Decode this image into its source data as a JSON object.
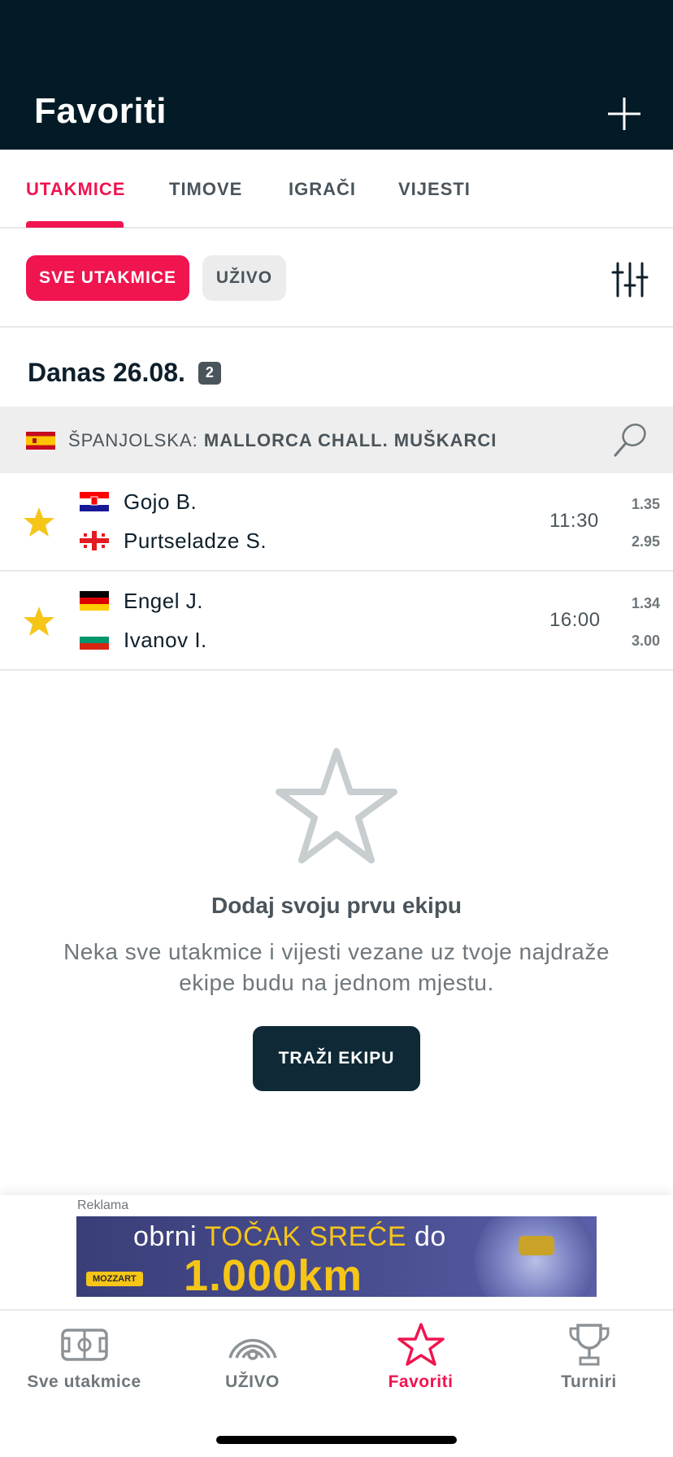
{
  "header": {
    "title": "Favoriti",
    "add_icon": "plus-icon"
  },
  "tabs": [
    {
      "label": "UTAKMICE",
      "active": true
    },
    {
      "label": "TIMOVE",
      "active": false
    },
    {
      "label": "IGRAČI",
      "active": false
    },
    {
      "label": "VIJESTI",
      "active": false
    }
  ],
  "filters": {
    "all_label": "SVE UTAKMICE",
    "live_label": "UŽIVO",
    "settings_icon": "sliders-icon"
  },
  "date_section": {
    "title": "Danas 26.08.",
    "count": "2"
  },
  "league": {
    "country": "ŠPANJOLSKA: ",
    "name": "MALLORCA CHALL. MUŠKARCI",
    "flag": "spain-flag",
    "sport_icon": "tennis-racket-icon"
  },
  "matches": [
    {
      "home": "Gojo B.",
      "home_flag": "croatia-flag",
      "away": "Purtseladze S.",
      "away_flag": "georgia-flag",
      "time": "11:30",
      "odd_home": "1.35",
      "odd_away": "2.95"
    },
    {
      "home": "Engel J.",
      "home_flag": "germany-flag",
      "away": "Ivanov I.",
      "away_flag": "bulgaria-flag",
      "time": "16:00",
      "odd_home": "1.34",
      "odd_away": "3.00"
    }
  ],
  "empty_state": {
    "title": "Dodaj svoju prvu ekipu",
    "text": "Neka sve utakmice i vijesti vezane uz tvoje najdraže ekipe budu na jednom mjestu.",
    "button": "TRAŽI EKIPU"
  },
  "ad": {
    "label": "Reklama",
    "line1_prefix": "obrni ",
    "line1_highlight": "TOČAK SREĆE",
    "line1_suffix": " do",
    "line2": "1.000km",
    "logo": "MOZZART"
  },
  "bottom_nav": [
    {
      "label": "Sve utakmice",
      "icon": "field-icon",
      "active": false
    },
    {
      "label": "UŽIVO",
      "icon": "live-icon",
      "active": false
    },
    {
      "label": "Favoriti",
      "icon": "star-icon",
      "active": true
    },
    {
      "label": "Turniri",
      "icon": "trophy-icon",
      "active": false
    }
  ],
  "colors": {
    "accent": "#f0144f",
    "header_bg": "#031b26",
    "star": "#f5c518",
    "button_dark": "#0f2a36"
  }
}
